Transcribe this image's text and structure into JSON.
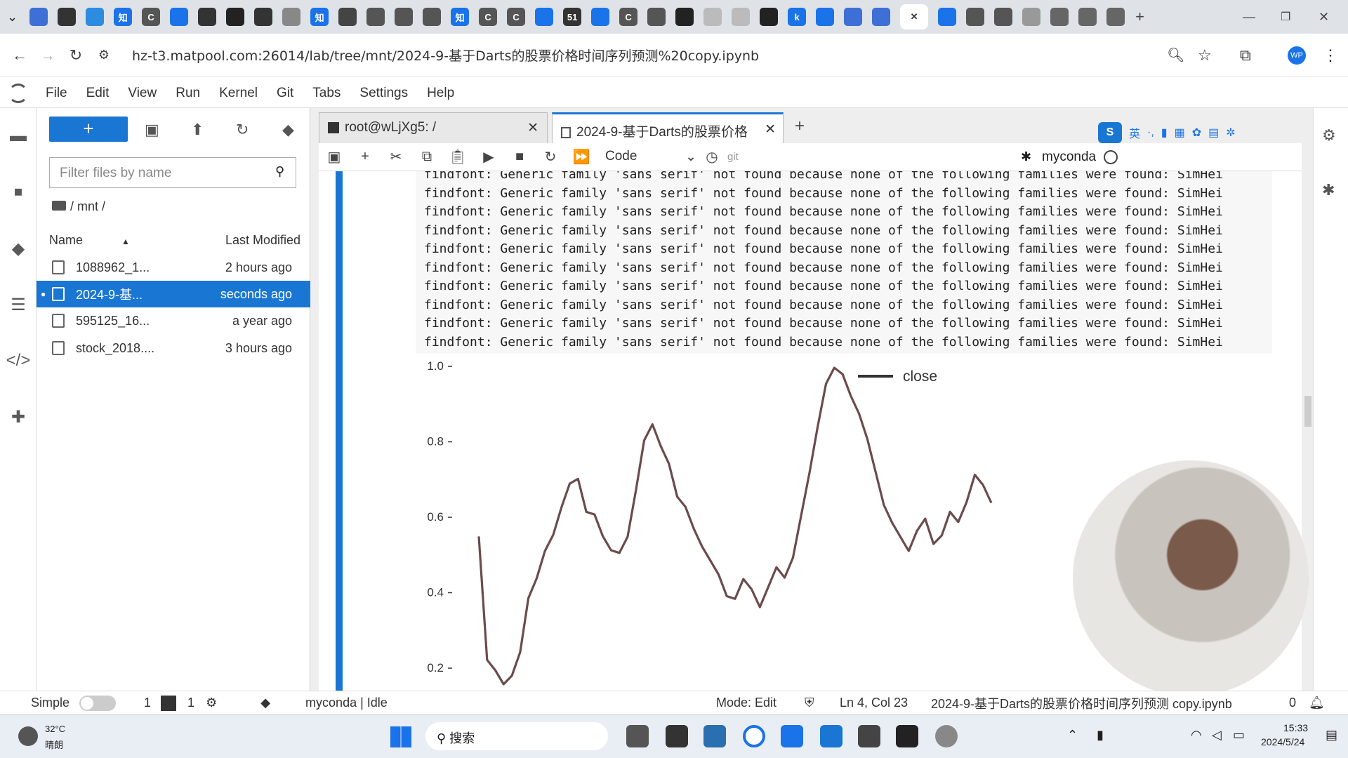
{
  "browser": {
    "tab_icons": [
      "知",
      "C",
      "C",
      "知",
      "51",
      "C",
      "C",
      "k",
      "知"
    ],
    "url": "hz-t3.matpool.com:26014/lab/tree/mnt/2024-9-基于Darts的股票价格时间序列预测%20copy.ipynb",
    "profile": "WP"
  },
  "menu": [
    "File",
    "Edit",
    "View",
    "Run",
    "Kernel",
    "Git",
    "Tabs",
    "Settings",
    "Help"
  ],
  "filebrowser": {
    "filter_placeholder": "Filter files by name",
    "breadcrumb": "/ mnt /",
    "col_name": "Name",
    "col_modified": "Last Modified",
    "files": [
      {
        "name": "1088962_1...",
        "modified": "2 hours ago"
      },
      {
        "name": "2024-9-基...",
        "modified": "seconds ago"
      },
      {
        "name": "595125_16...",
        "modified": "a year ago"
      },
      {
        "name": "stock_2018....",
        "modified": "3 hours ago"
      }
    ]
  },
  "tabs": {
    "terminal": "root@wLjXg5: /",
    "notebook": "2024-9-基于Darts的股票价格"
  },
  "toolbar": {
    "cell_type": "Code",
    "git_label": "git",
    "kernel": "myconda"
  },
  "output_line": "findfont: Generic family 'sans serif' not found because none of the following families were found: SimHei",
  "chart_data": {
    "type": "line",
    "series": [
      {
        "name": "close"
      }
    ],
    "y_ticks": [
      "1.0",
      "0.8",
      "0.6",
      "0.4",
      "0.2"
    ],
    "ylim": [
      0.2,
      1.0
    ],
    "values": [
      0.54,
      0.22,
      0.2,
      0.15,
      0.18,
      0.25,
      0.38,
      0.44,
      0.52,
      0.55,
      0.63,
      0.68,
      0.7,
      0.62,
      0.6,
      0.55,
      0.52,
      0.5,
      0.55,
      0.68,
      0.8,
      0.85,
      0.78,
      0.74,
      0.66,
      0.62,
      0.57,
      0.53,
      0.48,
      0.45,
      0.4,
      0.38,
      0.44,
      0.4,
      0.36,
      0.42,
      0.46,
      0.44,
      0.5,
      0.6,
      0.72,
      0.85,
      0.95,
      1.0,
      0.97,
      0.92,
      0.88,
      0.8,
      0.72,
      0.64,
      0.58,
      0.55,
      0.52,
      0.56,
      0.6,
      0.52,
      0.55,
      0.62,
      0.58,
      0.64,
      0.72,
      0.68,
      0.64
    ]
  },
  "status": {
    "mode_label": "Simple",
    "terminals": "1",
    "kernels": "1",
    "kernel_state": "myconda | Idle",
    "mode": "Mode: Edit",
    "position": "Ln 4, Col 23",
    "filename": "2024-9-基于Darts的股票价格时间序列预测 copy.ipynb",
    "notifications": "0"
  },
  "taskbar": {
    "weather_temp": "32°C",
    "weather_desc": "晴朗",
    "search": "搜索",
    "time": "15:33",
    "date": "2024/5/24"
  },
  "colors": {
    "accent": "#1976d2",
    "line": "#6b4b4b"
  }
}
